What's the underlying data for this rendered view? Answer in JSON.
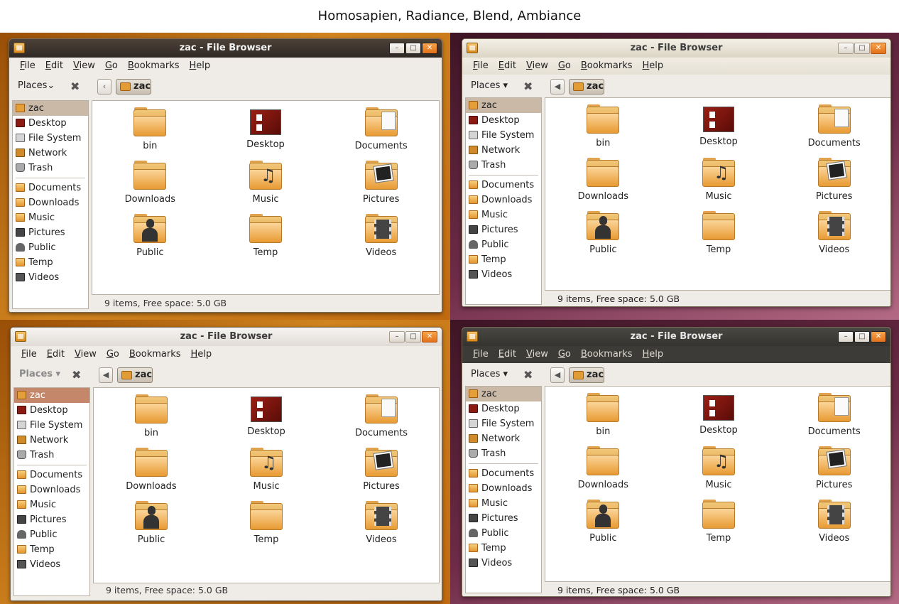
{
  "page_title": "Homosapien, Radiance, Blend, Ambiance",
  "window_title": "zac - File Browser",
  "menu": [
    "File",
    "Edit",
    "View",
    "Go",
    "Bookmarks",
    "Help"
  ],
  "window_buttons": {
    "minimize": "–",
    "maximize": "□",
    "close": "✕"
  },
  "toolbar": {
    "places_label_a": "Places⌄",
    "places_label_b": "Places ▾",
    "close_pane": "✖",
    "back": "◀",
    "back_homo": "‹",
    "path": "zac"
  },
  "sidebar": {
    "places": [
      {
        "label": "zac",
        "icon": "home-icon"
      },
      {
        "label": "Desktop",
        "icon": "desktop-icon"
      },
      {
        "label": "File System",
        "icon": "drive-icon"
      },
      {
        "label": "Network",
        "icon": "network-icon"
      },
      {
        "label": "Trash",
        "icon": "trash-icon"
      }
    ],
    "bookmarks": [
      {
        "label": "Documents",
        "icon": "documents-icon"
      },
      {
        "label": "Downloads",
        "icon": "folder-icon"
      },
      {
        "label": "Music",
        "icon": "music-icon"
      },
      {
        "label": "Pictures",
        "icon": "pictures-icon"
      },
      {
        "label": "Public",
        "icon": "user-icon"
      },
      {
        "label": "Temp",
        "icon": "folder-icon"
      },
      {
        "label": "Videos",
        "icon": "film-icon"
      }
    ]
  },
  "files": [
    {
      "name": "bin",
      "type": "folder"
    },
    {
      "name": "Desktop",
      "type": "desktop"
    },
    {
      "name": "Documents",
      "type": "doc"
    },
    {
      "name": "Downloads",
      "type": "folder"
    },
    {
      "name": "Music",
      "type": "note"
    },
    {
      "name": "Pictures",
      "type": "pic"
    },
    {
      "name": "Public",
      "type": "person"
    },
    {
      "name": "Temp",
      "type": "folder"
    },
    {
      "name": "Videos",
      "type": "film"
    }
  ],
  "status": "9 items, Free space: 5.0 GB",
  "themes": [
    "Homosapien",
    "Radiance",
    "Blend",
    "Ambiance"
  ]
}
